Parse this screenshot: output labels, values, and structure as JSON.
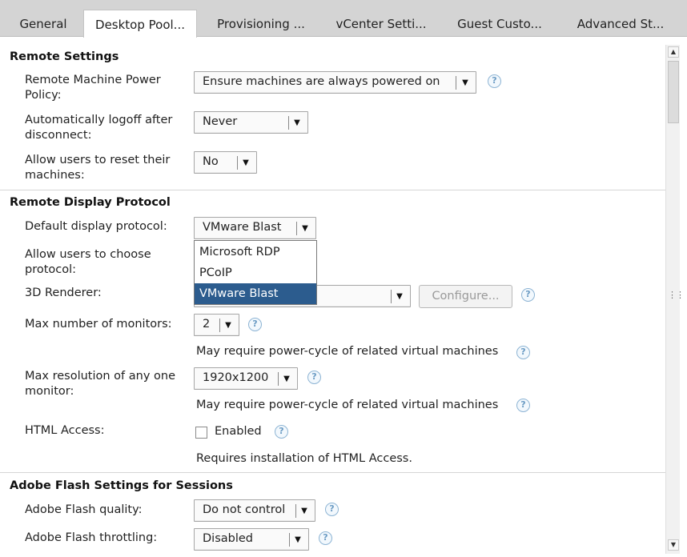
{
  "tabs": [
    {
      "label": "General"
    },
    {
      "label": "Desktop Pool..."
    },
    {
      "label": "Provisioning ..."
    },
    {
      "label": "vCenter Setti..."
    },
    {
      "label": "Guest Custo..."
    },
    {
      "label": "Advanced St..."
    }
  ],
  "active_tab": "Desktop Pool...",
  "remote_settings": {
    "header": "Remote Settings",
    "power_policy": {
      "label": "Remote Machine Power Policy:",
      "value": "Ensure machines are always powered on"
    },
    "auto_logoff": {
      "label": "Automatically logoff after disconnect:",
      "value": "Never"
    },
    "allow_reset": {
      "label": "Allow users to reset their machines:",
      "value": "No"
    }
  },
  "remote_display": {
    "header": "Remote Display Protocol",
    "default_protocol": {
      "label": "Default display protocol:",
      "value": "VMware Blast",
      "options": [
        "Microsoft RDP",
        "PCoIP",
        "VMware Blast"
      ]
    },
    "allow_choose": {
      "label": "Allow users to choose protocol:"
    },
    "renderer": {
      "label": "3D Renderer:",
      "configure_label": "Configure..."
    },
    "max_monitors": {
      "label": "Max number of monitors:",
      "value": "2",
      "note": "May require power-cycle of related virtual machines"
    },
    "max_resolution": {
      "label": "Max resolution of any one monitor:",
      "value": "1920x1200",
      "note": "May require power-cycle of related virtual machines"
    },
    "html_access": {
      "label": "HTML Access:",
      "checkbox_label": "Enabled",
      "note": "Requires installation of HTML Access."
    }
  },
  "adobe_flash": {
    "header": "Adobe Flash Settings for Sessions",
    "quality": {
      "label": "Adobe Flash quality:",
      "value": "Do not control"
    },
    "throttling": {
      "label": "Adobe Flash throttling:",
      "value": "Disabled"
    }
  },
  "icons": {
    "help": "help-icon",
    "arrow": "chevron-down-icon",
    "scroll_up": "scroll-up-icon",
    "scroll_down": "scroll-down-icon"
  },
  "colors": {
    "selected_option_bg": "#2c5c8e",
    "help_icon": "#6c9cc4",
    "tabbar_bg": "#d4d4d4"
  }
}
